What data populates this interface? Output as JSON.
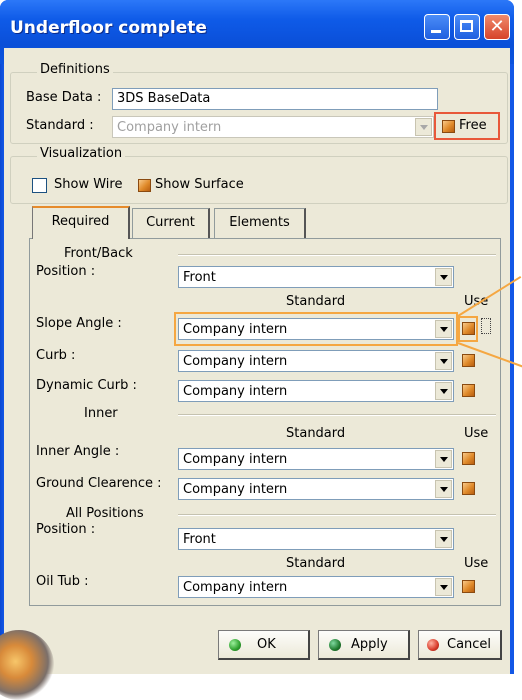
{
  "window": {
    "title": "Underfloor complete"
  },
  "definitions": {
    "legend": "Definitions",
    "base_data_label": "Base Data :",
    "base_data_value": "3DS BaseData",
    "standard_label": "Standard :",
    "standard_value": "Company intern",
    "free_label": "Free"
  },
  "visualization": {
    "legend": "Visualization",
    "show_wire_label": "Show Wire",
    "show_surface_label": "Show Surface"
  },
  "tabs": [
    {
      "label": "Required"
    },
    {
      "label": "Current"
    },
    {
      "label": "Elements"
    }
  ],
  "front_back": {
    "heading": "Front/Back",
    "position_label": "Position :",
    "position_value": "Front",
    "standard_header": "Standard",
    "use_header": "Use",
    "slope_angle_label": "Slope Angle :",
    "slope_angle_value": "Company intern",
    "curb_label": "Curb :",
    "curb_value": "Company intern",
    "dynamic_curb_label": "Dynamic Curb :",
    "dynamic_curb_value": "Company intern"
  },
  "inner": {
    "heading": "Inner",
    "standard_header": "Standard",
    "use_header": "Use",
    "inner_angle_label": "Inner Angle :",
    "inner_angle_value": "Company intern",
    "ground_clearance_label": "Ground Clearence :",
    "ground_clearance_value": "Company intern"
  },
  "all_positions": {
    "heading": "All Positions",
    "position_label": "Position :",
    "position_value": "Front",
    "standard_header": "Standard",
    "use_header": "Use",
    "oil_tub_label": "Oil Tub :",
    "oil_tub_value": "Company intern"
  },
  "buttons": {
    "ok": "OK",
    "apply": "Apply",
    "cancel": "Cancel"
  },
  "colors": {
    "highlight_orange": "#f5a742",
    "highlight_red": "#e8583a",
    "ok_dot": "#2ea02e",
    "apply_dot": "#1f7a2e",
    "cancel_dot": "#d83a2a"
  }
}
